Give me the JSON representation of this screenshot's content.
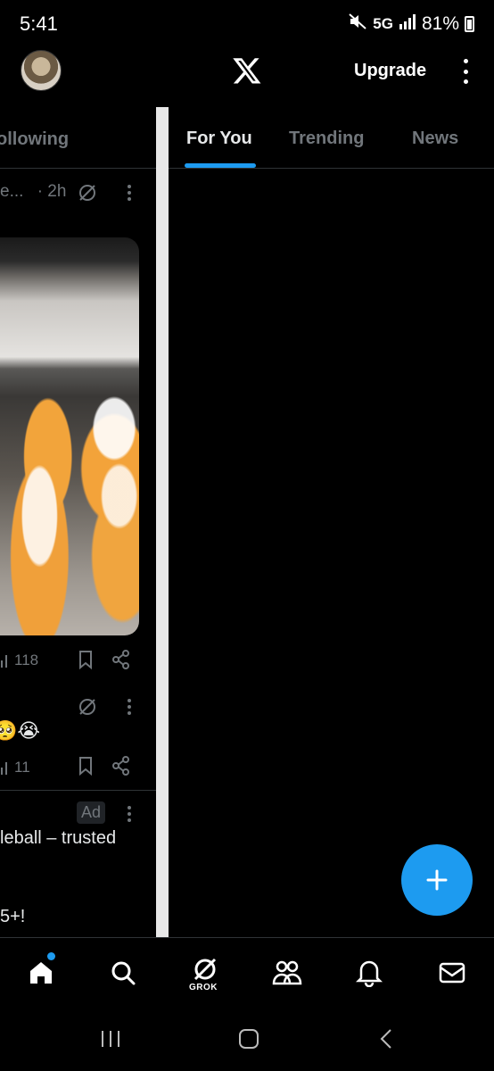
{
  "status_bar": {
    "time": "5:41",
    "network": "5G",
    "battery": "81%"
  },
  "header": {
    "upgrade_label": "Upgrade",
    "logo_icon": "x-logo-icon",
    "menu_icon": "more-vert-icon"
  },
  "left_panel": {
    "tab_label": "ollowing",
    "post": {
      "author_trunc": "e...",
      "time": "· 2h",
      "views": "118"
    },
    "post2": {
      "emojis": "🥺😭",
      "views": "11"
    },
    "ad": {
      "badge": "Ad",
      "line1": "leball – trusted",
      "line2": "5+!"
    }
  },
  "tabs": [
    {
      "label": "For You",
      "active": true
    },
    {
      "label": "Trending",
      "active": false
    },
    {
      "label": "News",
      "active": false
    }
  ],
  "bottom_nav": {
    "items": [
      "home-icon",
      "search-icon",
      "grok-icon",
      "communities-icon",
      "notifications-icon",
      "messages-icon"
    ],
    "grok_label": "GROK"
  },
  "colors": {
    "accent": "#1d9bf0",
    "background": "#000000",
    "muted_text": "#71767b"
  }
}
